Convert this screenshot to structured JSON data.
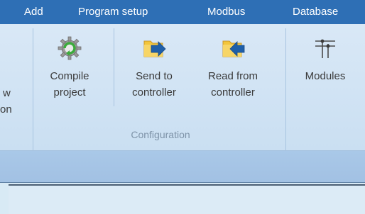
{
  "menubar": {
    "items": [
      {
        "label": "Add"
      },
      {
        "label": "Program setup"
      },
      {
        "label": "Modbus"
      },
      {
        "label": "Database"
      }
    ]
  },
  "ribbon": {
    "left_cut_label_top": "w",
    "left_cut_label_bottom": "on",
    "buttons": [
      {
        "line1": "Compile",
        "line2": "project",
        "icon": "gear-compile-icon"
      },
      {
        "line1": "Send to",
        "line2": "controller",
        "icon": "folder-arrow-right-icon"
      },
      {
        "line1": "Read from",
        "line2": "controller",
        "icon": "folder-arrow-left-icon"
      },
      {
        "line1": "Modules",
        "line2": "",
        "icon": "modules-icon"
      }
    ],
    "group_label": "Configuration"
  },
  "colors": {
    "menubar_bg": "#2e6fb5",
    "ribbon_bg": "#d9e8f6",
    "arrow_blue": "#1f5fa8",
    "folder_yellow": "#f3c53b"
  }
}
